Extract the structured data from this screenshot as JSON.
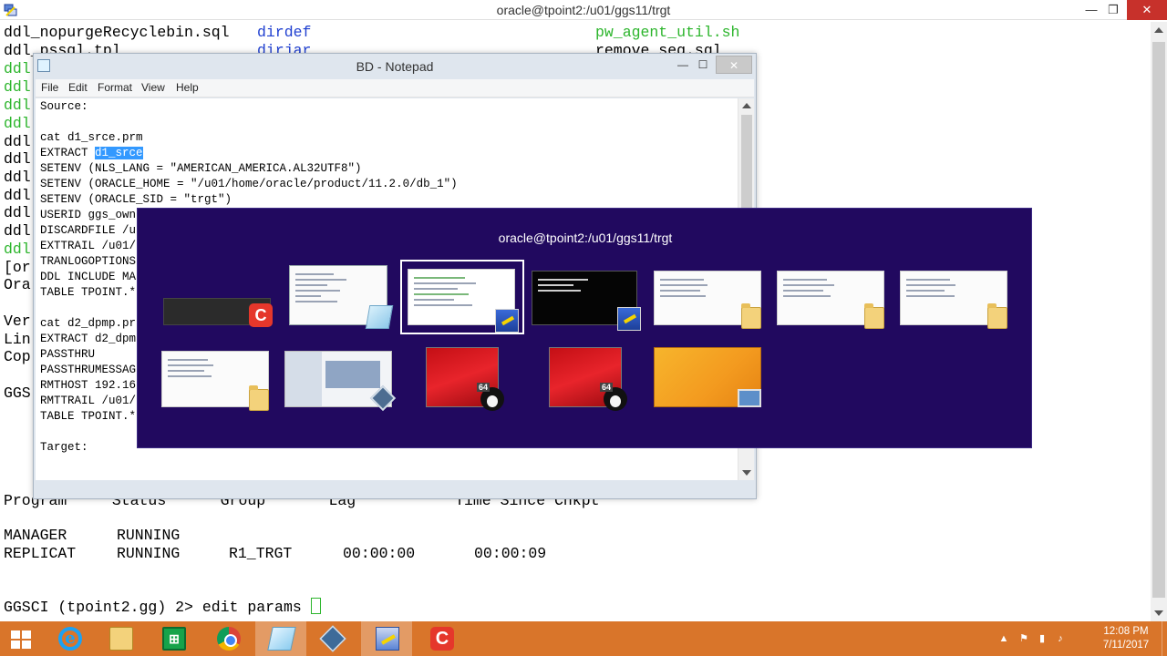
{
  "putty": {
    "title": "oracle@tpoint2:/u01/ggs11/trgt",
    "caption_buttons": {
      "minimize": "—",
      "maximize": "❐",
      "close": "✕"
    }
  },
  "terminal": {
    "row0": {
      "c1": "ddl_nopurgeRecyclebin.sql",
      "c2": "dirdef",
      "c3": "pw_agent_util.sh"
    },
    "row1": {
      "c1": "ddl_pssql.tpl",
      "c2": "dirjar",
      "c3": "remove_seq.sql"
    },
    "left_fragments": [
      "ddl",
      "ddl",
      "ddl",
      "ddl",
      "ddl",
      "ddl",
      "ddl",
      "ddl",
      "ddl",
      "ddl",
      "ddl",
      "[or",
      "Ora",
      "Ver",
      "Lin",
      "Cop",
      "GGS"
    ],
    "header": "Program     Status      Group       Lag           Time Since Chkpt",
    "manager": {
      "program": "MANAGER",
      "status": "RUNNING"
    },
    "replicat": {
      "program": "REPLICAT",
      "status": "RUNNING",
      "group": "R1_TRGT",
      "lag": "00:00:00",
      "since": "00:00:09"
    },
    "prompt": "GGSCI (tpoint2.gg) 2> edit params "
  },
  "notepad": {
    "title": "BD - Notepad",
    "menu": [
      "File",
      "Edit",
      "Format",
      "View",
      "Help"
    ],
    "caption_buttons": {
      "minimize": "—",
      "maximize": "☐",
      "close": "✕"
    },
    "lines": [
      "Source:",
      "",
      "cat d1_srce.prm",
      "",
      "SETENV (NLS_LANG = \"AMERICAN_AMERICA.AL32UTF8\")",
      "SETENV (ORACLE_HOME = \"/u01/home/oracle/product/11.2.0/db_1\")",
      "SETENV (ORACLE_SID = \"trgt\")",
      "USERID ggs_own",
      "DISCARDFILE /u",
      "EXTTRAIL /u01/",
      "TRANLOGOPTIONS",
      "DDL INCLUDE MA",
      "TABLE TPOINT.*",
      "",
      "cat d2_dpmp.pr",
      "EXTRACT d2_dpm",
      "PASSTHRU",
      "PASSTHRUMESSAG",
      "RMTHOST 192.16",
      "RMTTRAIL /u01/",
      "TABLE TPOINT.*",
      "",
      "Target:"
    ],
    "extract_prefix": "EXTRACT ",
    "extract_selected": "d1_srce"
  },
  "switcher": {
    "title": "oracle@tpoint2:/u01/ggs11/trgt",
    "windows": [
      {
        "id": "camtasia-recorder",
        "badge": "C"
      },
      {
        "id": "notepad-bd",
        "badge": "notepad"
      },
      {
        "id": "putty-trgt",
        "badge": "putty",
        "selected": true
      },
      {
        "id": "putty-src",
        "badge": "putty"
      },
      {
        "id": "explorer-1",
        "badge": "folder"
      },
      {
        "id": "explorer-2",
        "badge": "folder"
      },
      {
        "id": "explorer-3",
        "badge": "folder"
      },
      {
        "id": "explorer-4",
        "badge": "folder"
      },
      {
        "id": "virtualbox",
        "badge": "virtualbox"
      },
      {
        "id": "vm-linux-1",
        "badge": "tux",
        "label": "64"
      },
      {
        "id": "vm-linux-2",
        "badge": "tux",
        "label": "64"
      },
      {
        "id": "desktop",
        "badge": "desktop"
      }
    ]
  },
  "taskbar": {
    "apps": [
      "start",
      "internet-explorer",
      "file-explorer",
      "store",
      "chrome",
      "notepad",
      "virtualbox",
      "putty",
      "camtasia"
    ],
    "store_label": "⊞",
    "ie_label": "e",
    "camtasia_label": "C",
    "clock": {
      "time": "12:08 PM",
      "date": "7/11/2017"
    },
    "tray_icons": [
      "▲",
      "⚑",
      "▮",
      "♪"
    ]
  },
  "colors": {
    "switcher_bg": "#21095f",
    "taskbar_bg": "#d9752a",
    "terminal_green": "#2cb52c",
    "terminal_blue": "#1f3fd0",
    "selection": "#3399ff"
  }
}
